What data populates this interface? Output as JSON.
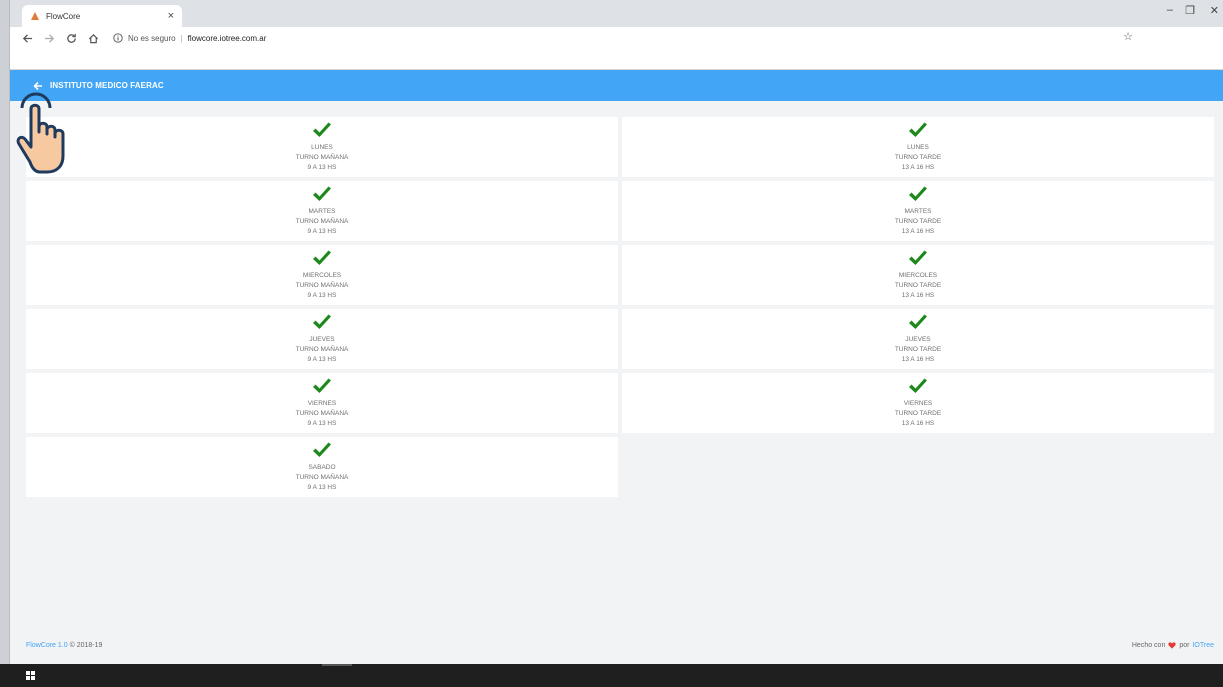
{
  "browser": {
    "tab_title": "FlowCore",
    "tab_close": "×",
    "security_text": "No es seguro",
    "separator": "|",
    "url": "flowcore.iotree.com.ar",
    "window_controls": {
      "minimize": "–",
      "maximize": "❐",
      "close": "✕"
    }
  },
  "header": {
    "title": "INSTITUTO MEDICO FAERAC"
  },
  "turnos": [
    {
      "day": "LUNES",
      "shift": "TURNO MAÑANA",
      "hours": "9 A 13 HS"
    },
    {
      "day": "LUNES",
      "shift": "TURNO TARDE",
      "hours": "13 A 16 HS"
    },
    {
      "day": "MARTES",
      "shift": "TURNO MAÑANA",
      "hours": "9 A 13 HS"
    },
    {
      "day": "MARTES",
      "shift": "TURNO TARDE",
      "hours": "13 A 16 HS"
    },
    {
      "day": "MIERCOLES",
      "shift": "TURNO MAÑANA",
      "hours": "9 A 13 HS"
    },
    {
      "day": "MIERCOLES",
      "shift": "TURNO TARDE",
      "hours": "13 A 16 HS"
    },
    {
      "day": "JUEVES",
      "shift": "TURNO MAÑANA",
      "hours": "9 A 13 HS"
    },
    {
      "day": "JUEVES",
      "shift": "TURNO TARDE",
      "hours": "13 A 16 HS"
    },
    {
      "day": "VIERNES",
      "shift": "TURNO MAÑANA",
      "hours": "9 A 13 HS"
    },
    {
      "day": "VIERNES",
      "shift": "TURNO TARDE",
      "hours": "13 A 16 HS"
    },
    {
      "day": "SABADO",
      "shift": "TURNO MAÑANA",
      "hours": "9 A 13 HS"
    }
  ],
  "footer": {
    "brand": "FlowCore 1.0",
    "copyright": "© 2018-19",
    "made_with": "Hecho con",
    "by": "por",
    "company": "IOTree"
  },
  "colors": {
    "accent": "#42a5f5",
    "check": "#1b8a1b",
    "heart": "#e53935"
  },
  "icons": {
    "back": "arrow-left-icon",
    "check": "checkmark-icon",
    "cursor": "pointing-hand-icon"
  }
}
